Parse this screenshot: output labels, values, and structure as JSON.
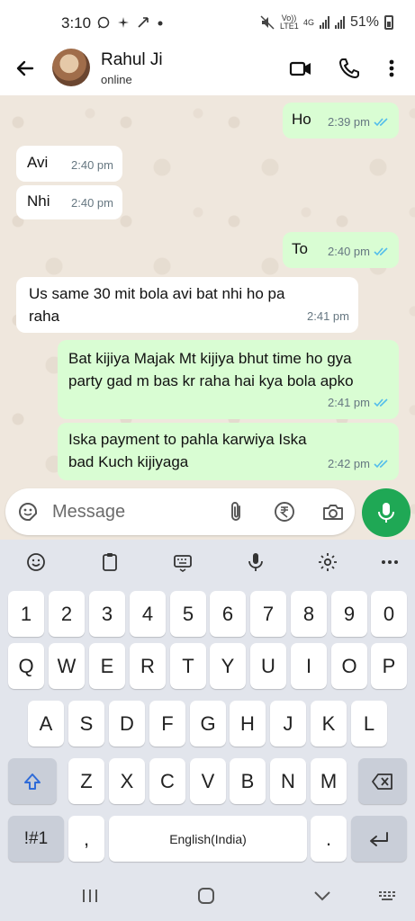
{
  "status_bar": {
    "time": "3:10",
    "network_label_top": "Vo)) LTE1",
    "network_label_4g": "4G",
    "battery": "51%"
  },
  "header": {
    "contact_name": "Rahul Ji",
    "contact_status": "online"
  },
  "messages": [
    {
      "direction": "out",
      "text": "Ho",
      "time": "2:39 pm",
      "read": true
    },
    {
      "direction": "in",
      "text": "Avi",
      "time": "2:40 pm"
    },
    {
      "direction": "in",
      "text": "Nhi",
      "time": "2:40 pm"
    },
    {
      "direction": "out",
      "text": "To",
      "time": "2:40 pm",
      "read": true
    },
    {
      "direction": "in",
      "text": "Us same 30 mit bola avi bat nhi ho pa raha",
      "time": "2:41 pm"
    },
    {
      "direction": "out",
      "text": "Bat kijiya Majak Mt kijiya bhut time ho gya party gad m bas kr raha hai kya bola apko",
      "time": "2:41 pm",
      "read": true
    },
    {
      "direction": "out",
      "text": "Iska payment to pahla karwiya Iska bad Kuch kijiyaga",
      "time": "2:42 pm",
      "read": true
    }
  ],
  "composer": {
    "placeholder": "Message",
    "value": ""
  },
  "keyboard": {
    "row_numbers": [
      "1",
      "2",
      "3",
      "4",
      "5",
      "6",
      "7",
      "8",
      "9",
      "0"
    ],
    "row_top": [
      "Q",
      "W",
      "E",
      "R",
      "T",
      "Y",
      "U",
      "I",
      "O",
      "P"
    ],
    "row_mid": [
      "A",
      "S",
      "D",
      "F",
      "G",
      "H",
      "J",
      "K",
      "L"
    ],
    "row_bottom": [
      "Z",
      "X",
      "C",
      "V",
      "B",
      "N",
      "M"
    ],
    "symbols_label": "!#1",
    "comma": ",",
    "space_label": "English(India)",
    "period": "."
  },
  "colors": {
    "chat_bg": "#efe7dd",
    "incoming_bubble": "#ffffff",
    "outgoing_bubble": "#d9fdd3",
    "mic_button": "#1fa855",
    "read_tick": "#53bdeb"
  },
  "icons": {
    "back": "arrow-left",
    "video": "video-camera",
    "call": "phone",
    "menu": "vertical-dots",
    "sticker": "sticker-smile",
    "attach": "paperclip",
    "payment": "rupee-circle",
    "camera": "camera",
    "mic": "microphone"
  }
}
